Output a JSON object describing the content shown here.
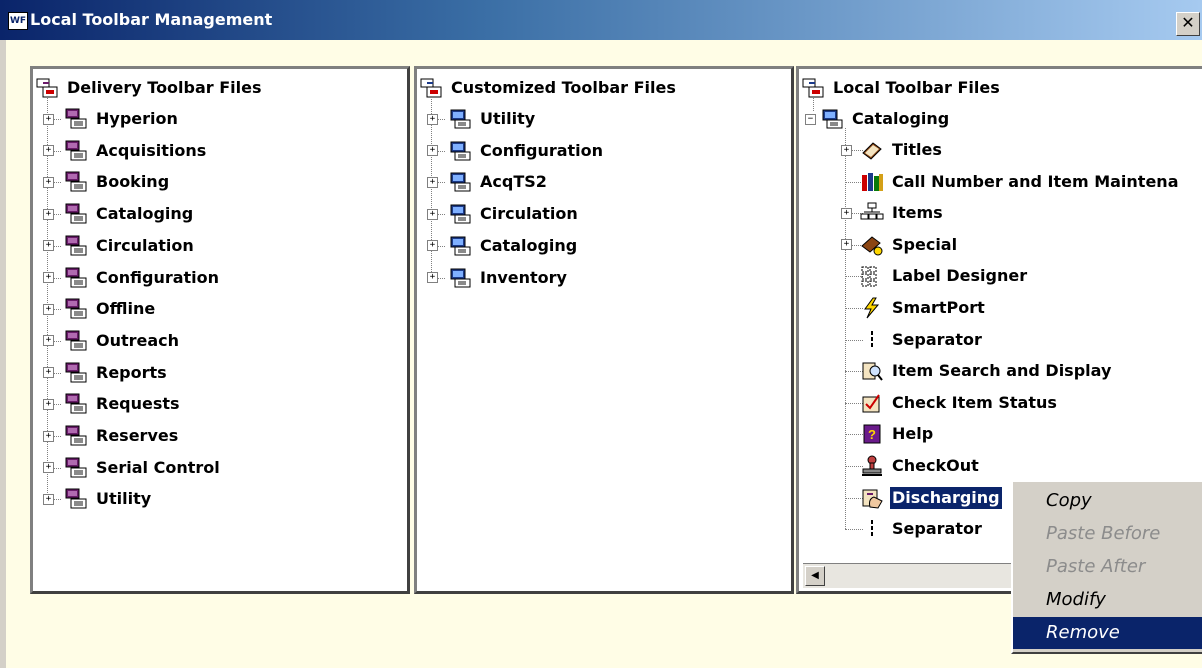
{
  "window": {
    "title": "Local Toolbar Management",
    "app_icon_text": "WF",
    "close_glyph": "✕"
  },
  "pane_delivery": {
    "root": "Delivery Toolbar Files",
    "items": [
      "Hyperion",
      "Acquisitions",
      "Booking",
      "Cataloging",
      "Circulation",
      "Configuration",
      "Offline",
      "Outreach",
      "Reports",
      "Requests",
      "Reserves",
      "Serial Control",
      "Utility"
    ]
  },
  "pane_customized": {
    "root": "Customized Toolbar Files",
    "items": [
      "Utility",
      "Configuration",
      "AcqTS2",
      "Circulation",
      "Cataloging",
      "Inventory"
    ]
  },
  "pane_local": {
    "root": "Local Toolbar Files",
    "group": "Cataloging",
    "items": [
      {
        "label": "Titles",
        "icon": "titles-book-icon",
        "expandable": true
      },
      {
        "label": "Call Number and Item Maintena",
        "icon": "books-icon",
        "expandable": false
      },
      {
        "label": "Items",
        "icon": "hierarchy-icon",
        "expandable": true
      },
      {
        "label": "Special",
        "icon": "special-book-icon",
        "expandable": true
      },
      {
        "label": "Label Designer",
        "icon": "label-grid-icon",
        "expandable": false
      },
      {
        "label": "SmartPort",
        "icon": "lightning-icon",
        "expandable": false
      },
      {
        "label": "Separator",
        "icon": "separator-icon",
        "expandable": false
      },
      {
        "label": "Item Search and Display",
        "icon": "item-search-icon",
        "expandable": false
      },
      {
        "label": "Check Item Status",
        "icon": "check-status-icon",
        "expandable": false
      },
      {
        "label": "Help",
        "icon": "help-icon",
        "expandable": false
      },
      {
        "label": "CheckOut",
        "icon": "stamp-icon",
        "expandable": false
      },
      {
        "label": "Discharging",
        "icon": "discharge-icon",
        "expandable": false,
        "selected": true
      },
      {
        "label": "Separator",
        "icon": "separator-icon",
        "expandable": false
      }
    ]
  },
  "context_menu": [
    {
      "label": "Copy",
      "enabled": true
    },
    {
      "label": "Paste Before",
      "enabled": false
    },
    {
      "label": "Paste After",
      "enabled": false
    },
    {
      "label": "Modify",
      "enabled": true
    },
    {
      "label": "Remove",
      "enabled": true,
      "highlighted": true
    }
  ],
  "scroll_left_glyph": "◀",
  "colors": {
    "selection": "#0a246a",
    "window_bg": "#d4d0c8",
    "client_bg": "#fffde6"
  }
}
